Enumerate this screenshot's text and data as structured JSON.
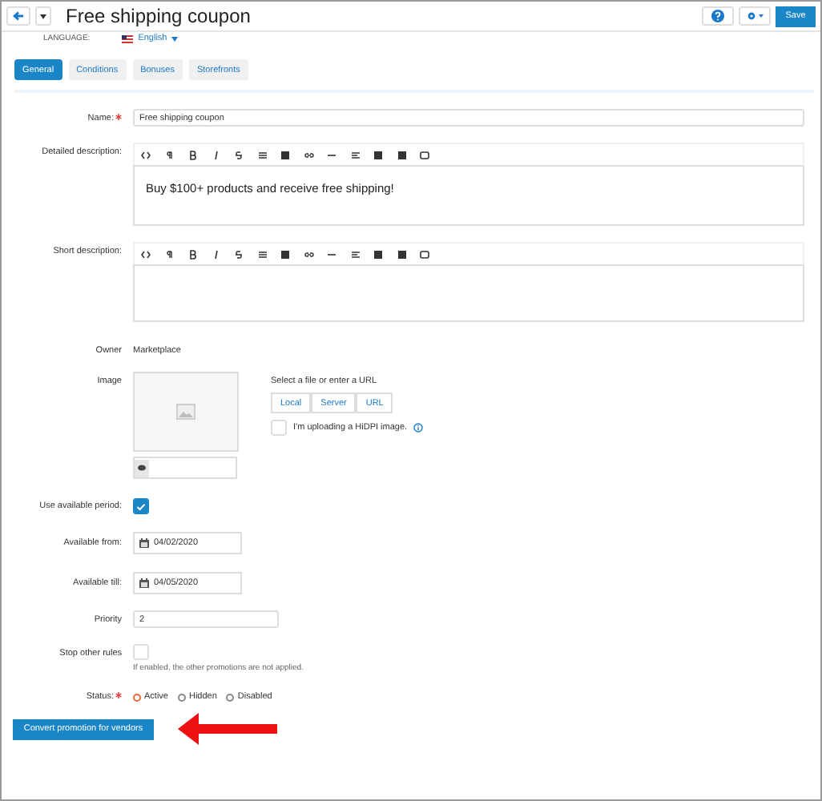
{
  "header": {
    "title": "Free shipping coupon",
    "save_label": "Save"
  },
  "language": {
    "label": "LANGUAGE:",
    "value": "English"
  },
  "tabs": [
    {
      "label": "General",
      "selected": true
    },
    {
      "label": "Conditions",
      "selected": false
    },
    {
      "label": "Bonuses",
      "selected": false
    },
    {
      "label": "Storefronts",
      "selected": false
    }
  ],
  "name": {
    "label": "Name:",
    "required": true,
    "value": "Free shipping coupon"
  },
  "detailed_description": {
    "label": "Detailed description:",
    "text": "Buy $100+ products and receive free shipping!"
  },
  "short_description": {
    "label": "Short description:"
  },
  "owner": {
    "label": "Owner",
    "value": "Marketplace"
  },
  "image": {
    "label": "Image",
    "prompt": "Select a file or enter a URL",
    "sources": [
      "Local",
      "Server",
      "URL"
    ],
    "hidpi_label": "I'm uploading a HiDPI image.",
    "hidpi_checked": false
  },
  "use_period": {
    "label": "Use available period:",
    "checked": true
  },
  "available_from": {
    "label": "Available from:",
    "value": "04/02/2020"
  },
  "available_till": {
    "label": "Available till:",
    "value": "04/05/2020"
  },
  "priority": {
    "label": "Priority",
    "value": "2"
  },
  "stop_rules": {
    "label": "Stop other rules",
    "checked": false,
    "hint": "If enabled, the other promotions are not applied."
  },
  "status": {
    "label": "Status:",
    "required": true,
    "options": [
      {
        "label": "Active",
        "selected": true
      },
      {
        "label": "Hidden",
        "selected": false
      },
      {
        "label": "Disabled",
        "selected": false
      }
    ]
  },
  "convert_button": "Convert promotion for vendors"
}
